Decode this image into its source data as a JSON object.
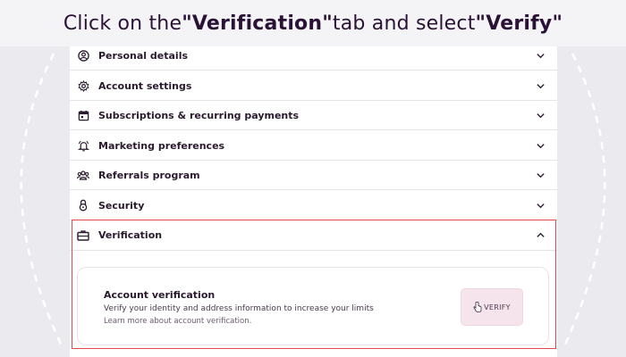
{
  "banner": {
    "prefix": "Click on the ",
    "tab_quoted": "\"Verification\"",
    "middle": " tab and select ",
    "action_quoted": "\"Verify\""
  },
  "sections": [
    {
      "label": "Personal details",
      "icon": "user-circle-icon",
      "expanded": false
    },
    {
      "label": "Account settings",
      "icon": "gear-icon",
      "expanded": false
    },
    {
      "label": "Subscriptions & recurring payments",
      "icon": "calendar-icon",
      "expanded": false
    },
    {
      "label": "Marketing preferences",
      "icon": "bell-icon",
      "expanded": false
    },
    {
      "label": "Referrals program",
      "icon": "users-icon",
      "expanded": false
    },
    {
      "label": "Security",
      "icon": "lock-icon",
      "expanded": false
    },
    {
      "label": "Verification",
      "icon": "briefcase-icon",
      "expanded": true
    }
  ],
  "verification_card": {
    "title": "Account verification",
    "description": "Verify your identity and address information to increase your limits",
    "link_text": "Learn more about account verification.",
    "button_label": "VERIFY"
  },
  "colors": {
    "highlight_border": "#e0494f",
    "button_bg": "#f6e4ec",
    "text": "#2a1a2e",
    "background": "#ebeaee"
  }
}
